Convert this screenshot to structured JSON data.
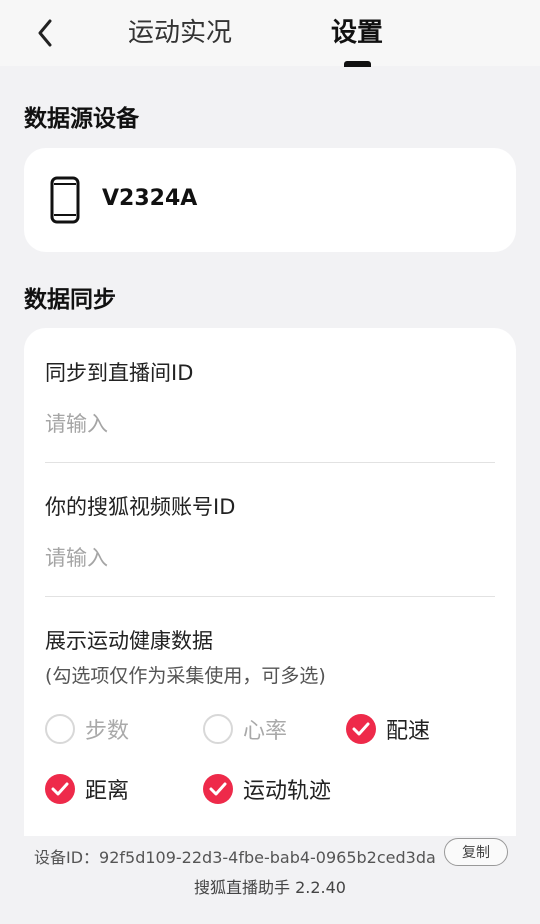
{
  "header": {
    "tabs": [
      {
        "label": "运动实况",
        "active": false
      },
      {
        "label": "设置",
        "active": true
      }
    ]
  },
  "data_source": {
    "title": "数据源设备",
    "device_icon": "phone-icon",
    "device_name": "V2324A"
  },
  "data_sync": {
    "title": "数据同步",
    "room_id": {
      "label": "同步到直播间ID",
      "placeholder": "请输入",
      "value": ""
    },
    "account_id": {
      "label": "你的搜狐视频账号ID",
      "placeholder": "请输入",
      "value": ""
    },
    "health": {
      "label": "展示运动健康数据",
      "hint": "(勾选项仅作为采集使用，可多选)",
      "options": [
        {
          "label": "步数",
          "checked": false
        },
        {
          "label": "心率",
          "checked": false
        },
        {
          "label": "配速",
          "checked": true
        },
        {
          "label": "距离",
          "checked": true
        },
        {
          "label": "运动轨迹",
          "checked": true
        }
      ]
    }
  },
  "footer": {
    "device_id": "设备ID：92f5d109-22d3-4fbe-bab4-0965b2ced3da",
    "copy_label": "复制",
    "version": "搜狐直播助手 2.2.40"
  },
  "colors": {
    "accent": "#ee2a4a",
    "background": "#f2f2f4",
    "card": "#ffffff"
  }
}
